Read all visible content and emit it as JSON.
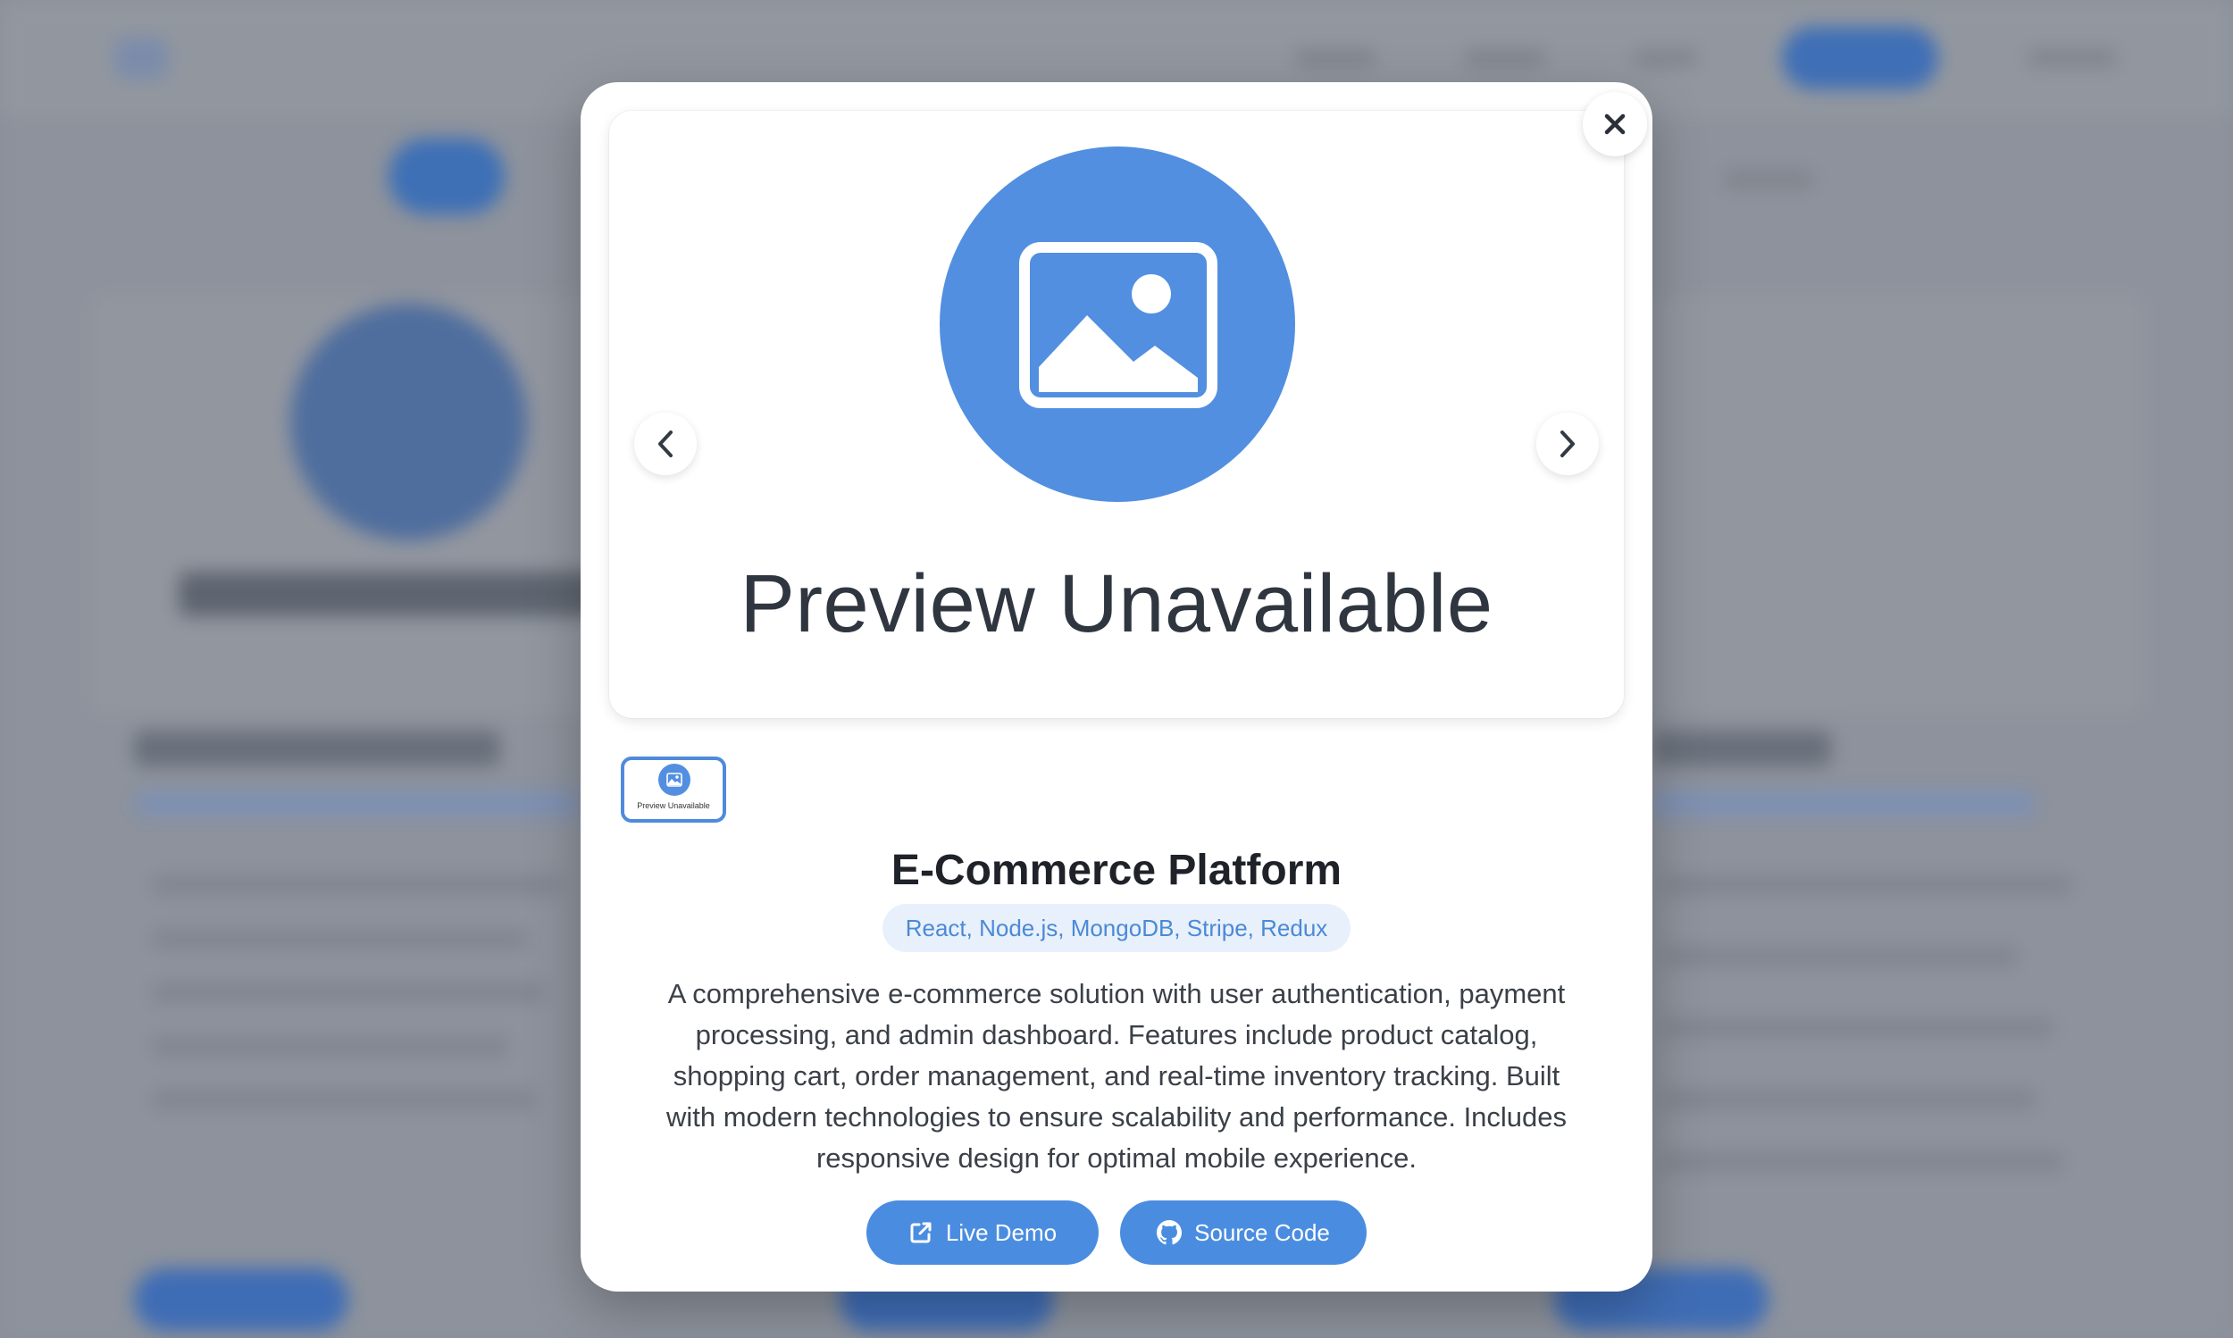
{
  "modal": {
    "preview_text": "Preview Unavailable",
    "thumbnail_text": "Preview Unavailable",
    "title": "E-Commerce Platform",
    "tech_stack": "React, Node.js, MongoDB, Stripe, Redux",
    "description": "A comprehensive e-commerce solution with user authentication, payment processing, and admin dashboard. Features include product catalog, shopping cart, order management, and real-time inventory tracking. Built with modern technologies to ensure scalability and performance. Includes responsive design for optimal mobile experience.",
    "buttons": {
      "live_demo": "Live Demo",
      "source_code": "Source Code"
    }
  },
  "icons": {
    "close": "close-icon",
    "prev": "chevron-left-icon",
    "next": "chevron-right-icon",
    "image": "image-icon",
    "external_link": "external-link-icon",
    "github": "github-icon"
  },
  "colors": {
    "accent": "#4a8de0",
    "badge_bg": "#e8f0fb",
    "badge_text": "#4b89d6",
    "title_text": "#1f2329",
    "body_text": "#3b4048"
  }
}
